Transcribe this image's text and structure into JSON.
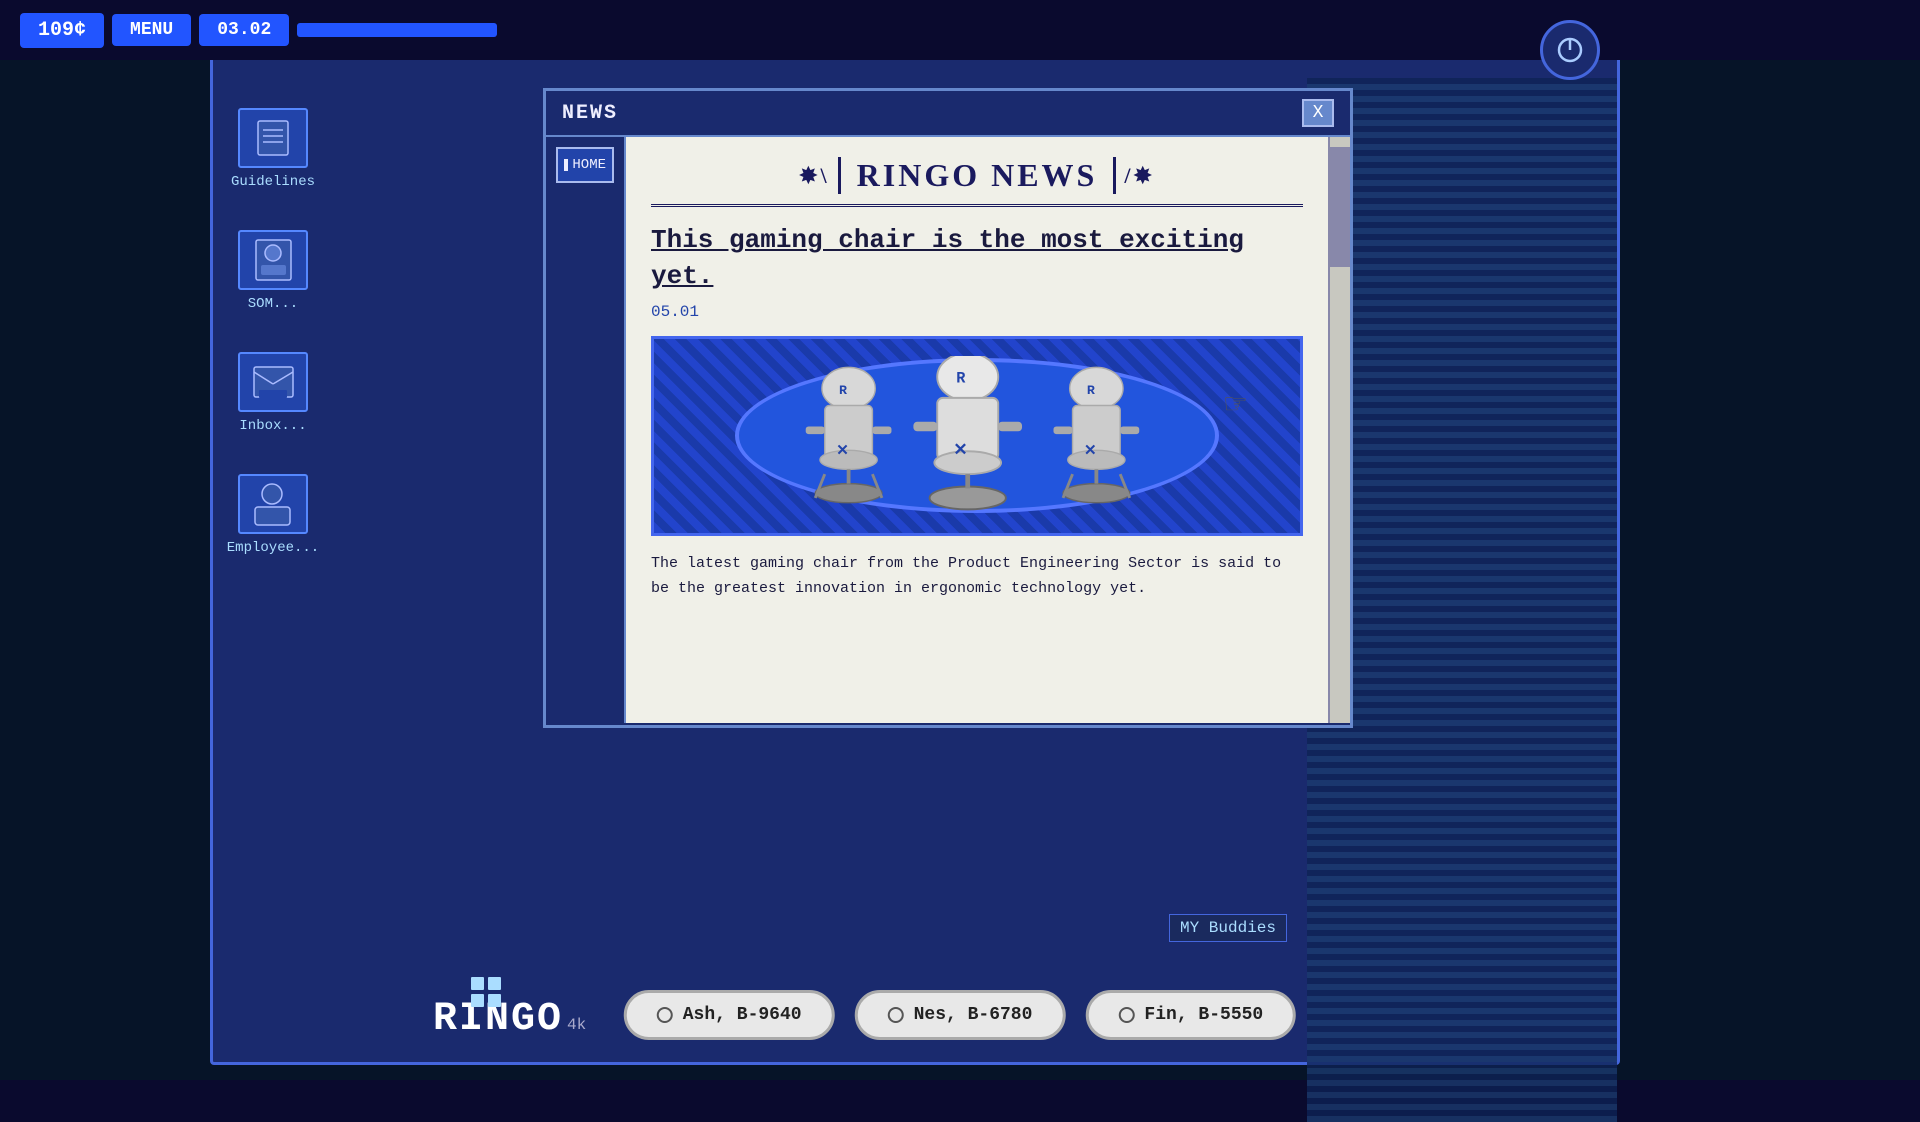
{
  "topbar": {
    "currency": "109¢",
    "menu": "MENU",
    "time": "03.02"
  },
  "power_button": "⏻",
  "news_window": {
    "title": "NEWS",
    "close": "X",
    "home_button": "HOME",
    "logo_left_deco": "✦|",
    "logo": "RINGO NEWS",
    "logo_right_deco": "|✦",
    "headline": "This gaming chair is the most exciting yet.",
    "date": "05.01",
    "body_text": "The latest gaming chair from the Product Engineering Sector is said to be the greatest innovation in ergonomic technology yet."
  },
  "desktop_icons": [
    {
      "label": "Guidelines"
    },
    {
      "label": "SOM..."
    },
    {
      "label": "Inbox..."
    },
    {
      "label": "Employee..."
    }
  ],
  "contact_buttons": [
    {
      "label": "Ash, B-9640"
    },
    {
      "label": "Nes, B-6780"
    },
    {
      "label": "Fin, B-5550"
    }
  ],
  "my_buddies": "MY Buddies",
  "ringo_logo": "RINGO",
  "ringo_sub": "4k"
}
